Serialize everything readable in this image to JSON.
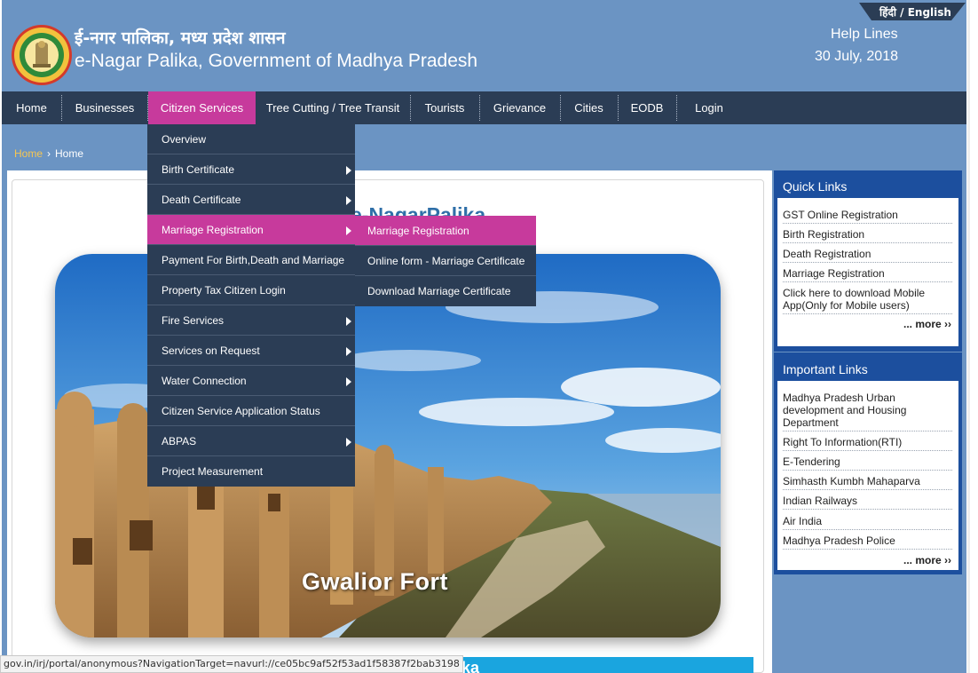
{
  "header": {
    "title_hindi": "ई-नगर पालिका, मध्य प्रदेश शासन",
    "title_english": "e-Nagar Palika, Government of Madhya Pradesh",
    "language_switch": "हिंदी / English",
    "help_lines": "Help Lines",
    "date": "30 July, 2018",
    "emblem_icon": "mp-government-emblem-icon"
  },
  "nav": {
    "items": [
      "Home",
      "Businesses",
      "Citizen Services",
      "Tree Cutting / Tree Transit",
      "Tourists",
      "Grievance",
      "Cities",
      "EODB",
      "Login"
    ],
    "active": "Citizen Services"
  },
  "breadcrumb": {
    "home": "Home",
    "separator": "›",
    "current": "Home"
  },
  "dropdown": {
    "items": [
      "Overview",
      "Birth Certificate",
      "Death Certificate",
      "Marriage Registration",
      "Payment For Birth,Death and Marriage",
      "Property Tax Citizen Login",
      "Fire Services",
      "Services on Request",
      "Water Connection",
      "Citizen Service Application Status",
      "ABPAS",
      "Project Measurement"
    ],
    "active": "Marriage Registration",
    "submenu": [
      "Marriage Registration",
      "Online form - Marriage Certificate",
      "Download Marriage Certificate"
    ]
  },
  "main": {
    "welcome_partial": "e-NagarPalika",
    "hero_caption": "Gwalior Fort",
    "bottom_bar_partial": "Palika"
  },
  "quick_links": {
    "title": "Quick Links",
    "items": [
      "GST Online Registration",
      "Birth Registration",
      "Death Registration",
      "Marriage Registration",
      "Click here to download Mobile App(Only for Mobile users)"
    ],
    "more": "... more ››"
  },
  "important_links": {
    "title": "Important Links",
    "items": [
      "Madhya Pradesh Urban development and Housing Department",
      "Right To Information(RTI)",
      "E-Tendering",
      "Simhasth Kumbh Mahaparva",
      "Indian Railways",
      "Air India",
      "Madhya Pradesh Police"
    ],
    "more": "... more ››"
  },
  "status_bar": {
    "url": "gov.in/irj/portal/anonymous?NavigationTarget=navurl://ce05bc9af52f53ad1f58387f2bab3198"
  },
  "colors": {
    "header_bg": "#6b94c3",
    "nav_bg": "#2b3d55",
    "accent_magenta": "#c73a9c",
    "sidebar_blue": "#1c4f9e",
    "breadcrumb_home": "#f6c652"
  }
}
